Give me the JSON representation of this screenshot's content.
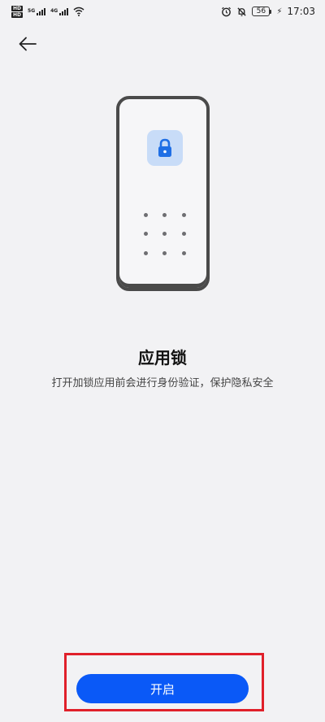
{
  "status_bar": {
    "hd1": "HD",
    "hd2": "HD",
    "net1": "5G",
    "net2": "4G",
    "battery_level": "56",
    "time": "17:03",
    "icons": [
      "alarm-icon",
      "mute-icon",
      "battery-icon",
      "charging-icon",
      "wifi-icon",
      "signal-icon"
    ]
  },
  "header": {
    "back_icon": "arrow-left-icon"
  },
  "illustration": {
    "lock_icon": "lock-icon",
    "lock_tile_color": "#c8dcf8",
    "lock_color": "#1f6fe5",
    "pattern_dots": 9
  },
  "content": {
    "title": "应用锁",
    "description": "打开加锁应用前会进行身份验证，保护隐私安全"
  },
  "actions": {
    "enable_label": "开启",
    "accent_color": "#0a59f7"
  }
}
